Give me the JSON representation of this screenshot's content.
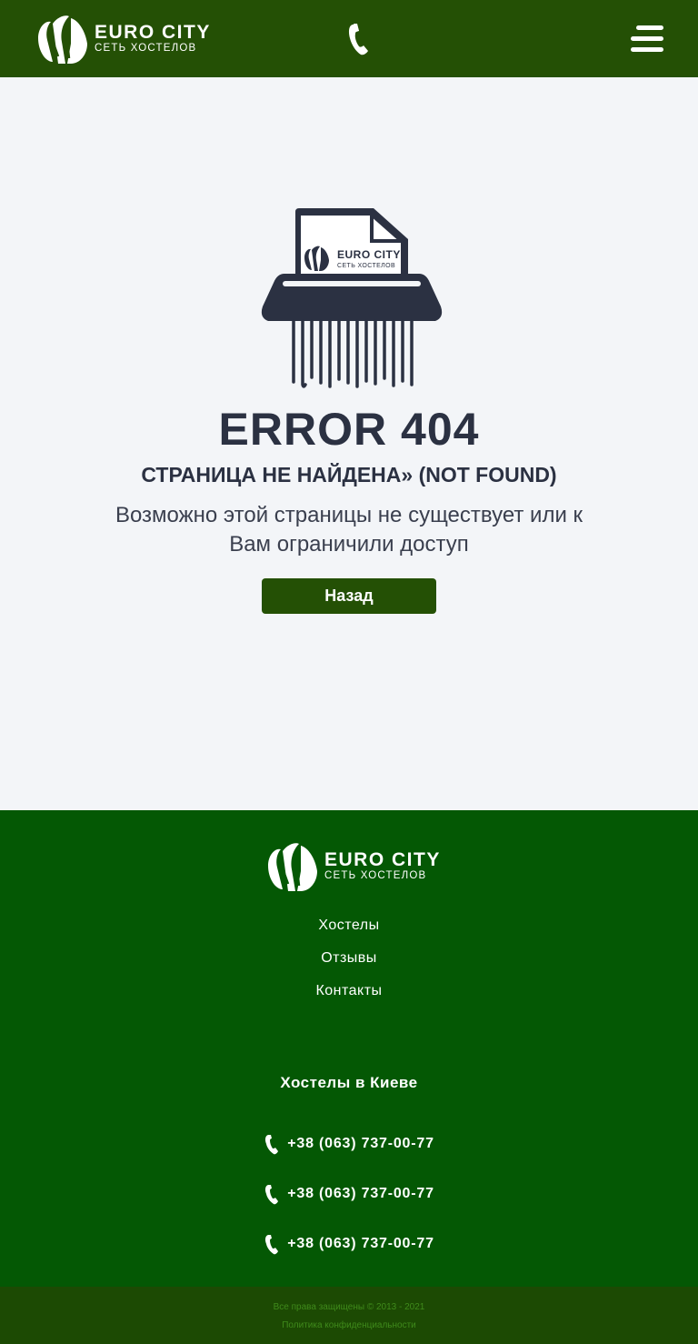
{
  "brand": {
    "name": "EURO CITY",
    "tagline": "СЕТЬ ХОСТЕЛОВ"
  },
  "header": {
    "phone_icon": "phone-icon",
    "menu_icon": "hamburger-menu-icon"
  },
  "error": {
    "illustration_icon": "paper-shredder-icon",
    "title": "ERROR 404",
    "subtitle": "СТРАНИЦА НЕ НАЙДЕНА» (NOT FOUND)",
    "description": "Возможно этой страницы не существует или к Вам ограничили доступ",
    "back_label": "Назад"
  },
  "footer": {
    "links": [
      "Хостелы",
      "Отзывы",
      "Контакты"
    ],
    "city_heading": "Хостелы в Киеве",
    "phones": [
      "+38 (063) 737-00-77",
      "+38 (063) 737-00-77",
      "+38 (063) 737-00-77"
    ],
    "copyright": "Все права защищены © 2013 - 2021",
    "privacy": "Политика конфиденциальности"
  },
  "colors": {
    "header_bg": "#245005",
    "footer_bg": "#045804",
    "bottom_bar_bg": "#1c4a03",
    "accent_button": "#245005",
    "text_dark": "#2b3142",
    "page_bg": "#f3f5f8"
  }
}
